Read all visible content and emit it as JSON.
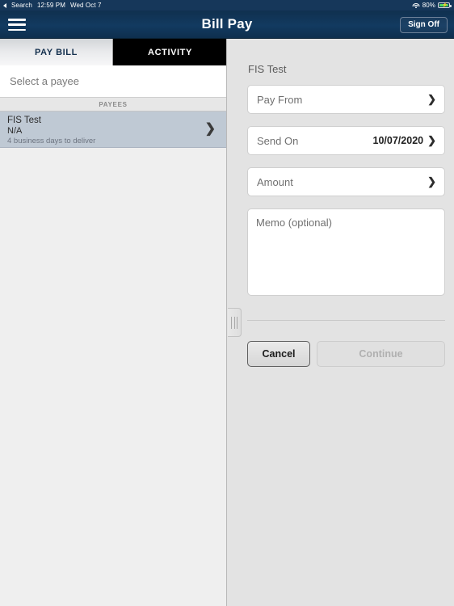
{
  "status_bar": {
    "back_label": "Search",
    "time": "12:59 PM",
    "date": "Wed Oct 7",
    "battery_percent": "80%",
    "wifi_icon": "wifi-icon",
    "battery_icon": "battery-charging-icon"
  },
  "nav": {
    "menu_icon": "hamburger-menu-icon",
    "title": "Bill Pay",
    "sign_off_label": "Sign Off"
  },
  "tabs": [
    {
      "label": "PAY BILL",
      "active": true
    },
    {
      "label": "ACTIVITY",
      "active": false
    }
  ],
  "left_pane": {
    "select_payee_label": "Select a payee",
    "section_header": "PAYEES",
    "payees": [
      {
        "name": "FIS Test",
        "sub": "N/A",
        "note": "4 business days to deliver",
        "chevron": "❯",
        "selected": true
      }
    ]
  },
  "form": {
    "title": "FIS Test",
    "fields": [
      {
        "label": "Pay From",
        "value": "",
        "chevron": "❯"
      },
      {
        "label": "Send On",
        "value": "10/07/2020",
        "chevron": "❯"
      },
      {
        "label": "Amount",
        "value": "",
        "chevron": "❯"
      }
    ],
    "memo_placeholder": "Memo (optional)",
    "cancel_label": "Cancel",
    "continue_label": "Continue",
    "continue_enabled": false
  },
  "colors": {
    "nav_blue": "#103355",
    "selected_row": "#bfc9d4",
    "panel_bg": "#e3e3e3",
    "battery_green": "#4cd964"
  }
}
